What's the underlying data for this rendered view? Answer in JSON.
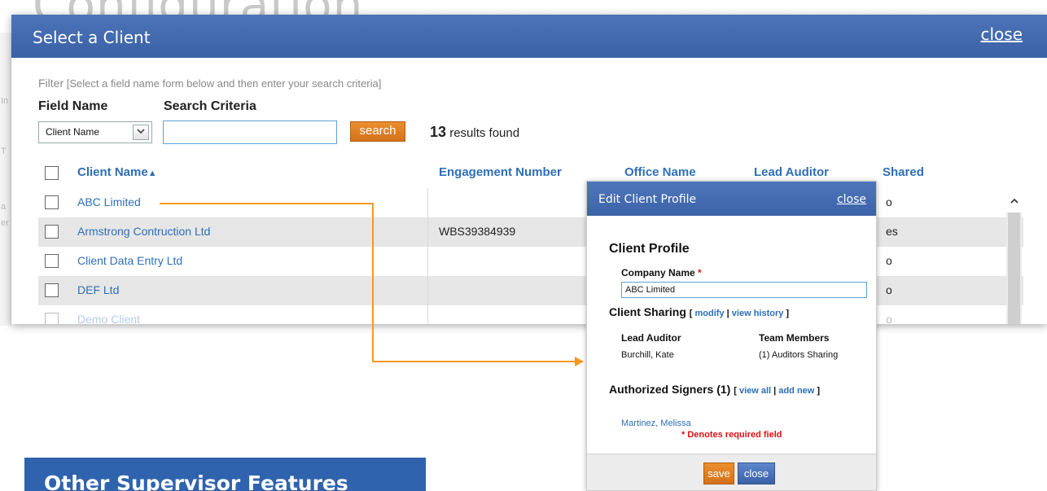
{
  "background": {
    "page_title_fragment": "Configuration",
    "left_fragments": [
      "In",
      "T",
      "a",
      "er"
    ]
  },
  "modal": {
    "title": "Select a Client",
    "close_label": "close",
    "filter_label": "Filter",
    "filter_hint": "[Select a field name form below and then enter your search criteria]",
    "field_name_label": "Field Name",
    "search_criteria_label": "Search Criteria",
    "field_name_value": "Client Name",
    "search_value": "",
    "search_button": "search",
    "results_count": "13",
    "results_text": "results found",
    "columns": {
      "client_name": "Client Name",
      "sort_icon": "▲",
      "engagement_number": "Engagement Number",
      "office_name": "Office Name",
      "lead_auditor": "Lead Auditor",
      "shared": "Shared"
    },
    "rows": [
      {
        "client_name": "ABC Limited",
        "engagement_number": "",
        "shared": "o"
      },
      {
        "client_name": "Armstrong Contruction Ltd",
        "engagement_number": "WBS39384939",
        "shared": "es"
      },
      {
        "client_name": "Client Data Entry Ltd",
        "engagement_number": "",
        "shared": "o"
      },
      {
        "client_name": "DEF Ltd",
        "engagement_number": "",
        "shared": "o"
      },
      {
        "client_name": "Demo Client",
        "engagement_number": "",
        "shared": "o"
      }
    ],
    "scroll_up_icon": "^"
  },
  "edit_panel": {
    "title": "Edit Client Profile",
    "close_label": "close",
    "client_profile_heading": "Client Profile",
    "company_name_label": "Company Name",
    "required_mark": "*",
    "company_name_value": "ABC Limited",
    "client_sharing_heading": "Client Sharing",
    "modify_link": "modify",
    "view_history_link": "view history",
    "lead_auditor_label": "Lead Auditor",
    "lead_auditor_value": "Burchill, Kate",
    "team_members_label": "Team Members",
    "team_members_value": "(1) Auditors Sharing",
    "authorized_signers_heading": "Authorized Signers (1)",
    "view_all_link": "view all",
    "add_new_link": "add new",
    "signer_name": "Martinez, Melissa",
    "required_note": "* Denotes required field",
    "save_button": "save",
    "close_button": "close"
  },
  "banner": {
    "text": "Other Supervisor Features"
  },
  "colors": {
    "header_blue": "#3f66ab",
    "link_blue": "#2e6fb7",
    "action_orange": "#e0801f",
    "connector_orange": "#f39a1e",
    "required_red": "#d11111"
  }
}
